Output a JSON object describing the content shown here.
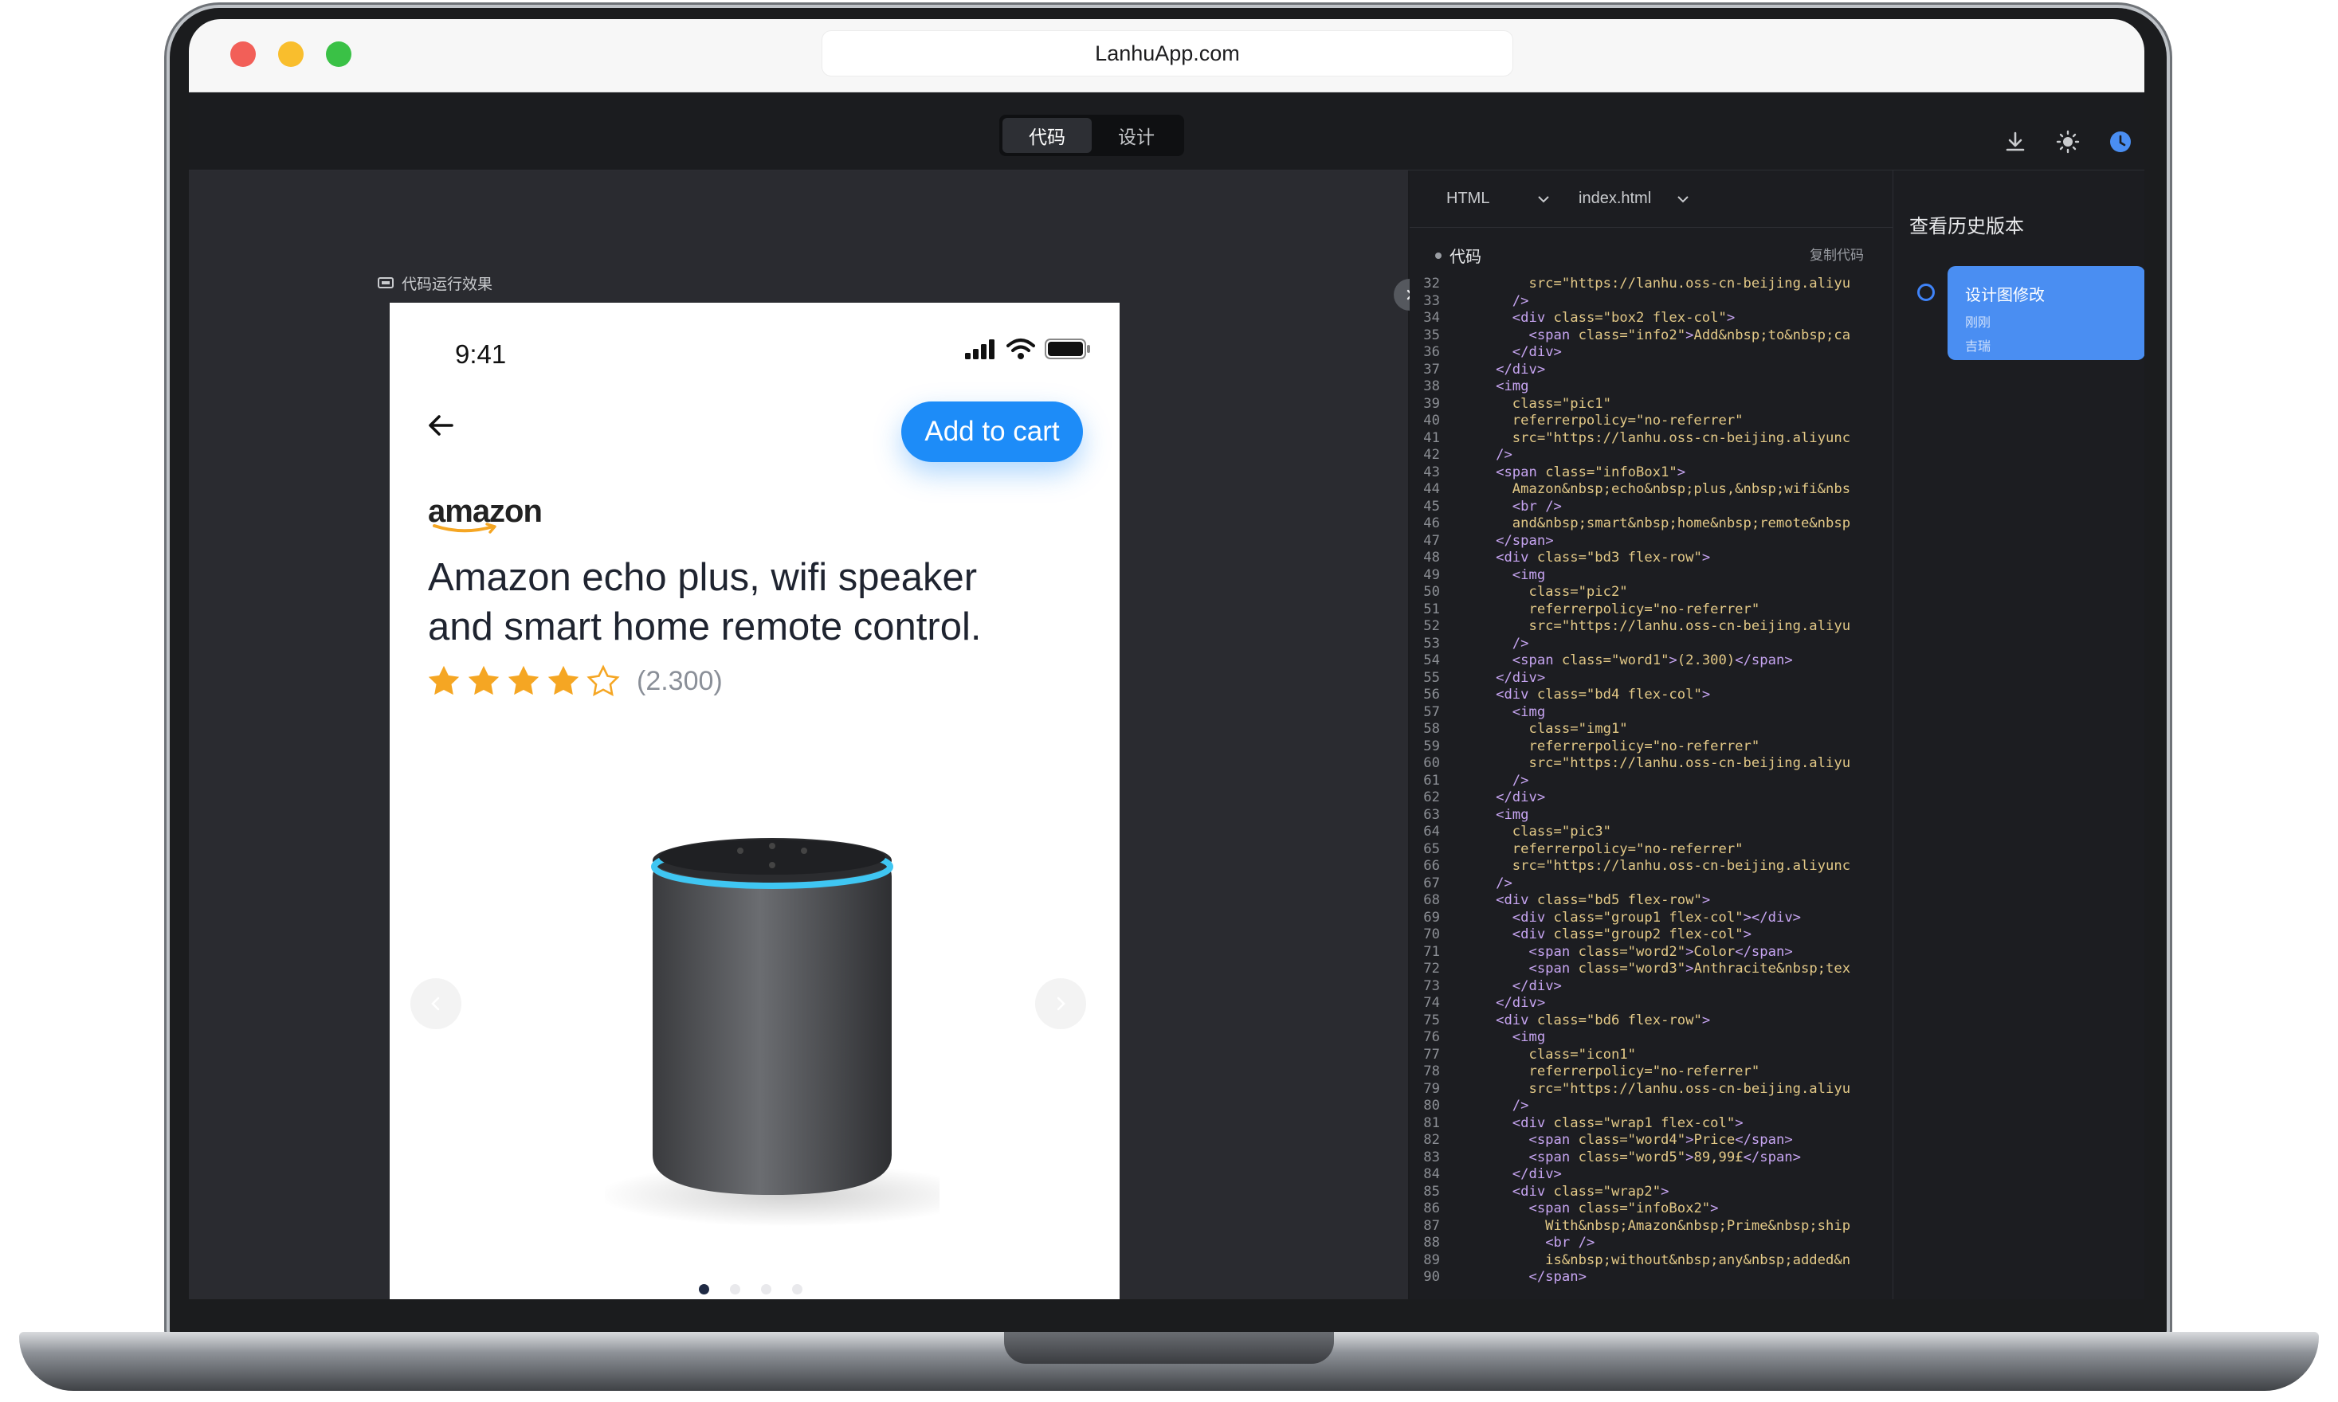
{
  "browser": {
    "url": "LanhuApp.com"
  },
  "topbar": {
    "tabs": [
      {
        "label": "代码",
        "active": true
      },
      {
        "label": "设计",
        "active": false
      }
    ],
    "icons": [
      "download-icon",
      "brightness-icon",
      "history-clock-icon"
    ]
  },
  "preview": {
    "label": "代码运行效果",
    "phone": {
      "time": "9:41",
      "add_to_cart": "Add to cart",
      "brand": "amazon",
      "title": "Amazon echo plus, wifi speaker and smart home remote control.",
      "rating_stars": 4,
      "rating_max": 5,
      "rating_count": "(2.300)",
      "carousel_pages": 4,
      "carousel_active": 1,
      "colors": {
        "accent": "#1d8cf8",
        "star": "#f5a623",
        "title": "#1f2430"
      }
    }
  },
  "code_panel": {
    "language_select": "HTML",
    "file_select": "index.html",
    "section_label": "代码",
    "copy_label": "复制代码",
    "lines": [
      {
        "n": "32",
        "t": "          src=\"https://lanhu.oss-cn-beijing.aliyu"
      },
      {
        "n": "33",
        "t": "        />"
      },
      {
        "n": "34",
        "t": "        <div class=\"box2 flex-col\">"
      },
      {
        "n": "35",
        "t": "          <span class=\"info2\">Add&nbsp;to&nbsp;ca"
      },
      {
        "n": "36",
        "t": "        </div>"
      },
      {
        "n": "37",
        "t": "      </div>"
      },
      {
        "n": "38",
        "t": "      <img"
      },
      {
        "n": "39",
        "t": "        class=\"pic1\""
      },
      {
        "n": "40",
        "t": "        referrerpolicy=\"no-referrer\""
      },
      {
        "n": "41",
        "t": "        src=\"https://lanhu.oss-cn-beijing.aliyunc"
      },
      {
        "n": "42",
        "t": "      />"
      },
      {
        "n": "43",
        "t": "      <span class=\"infoBox1\">"
      },
      {
        "n": "44",
        "t": "        Amazon&nbsp;echo&nbsp;plus,&nbsp;wifi&nbs"
      },
      {
        "n": "45",
        "t": "        <br />"
      },
      {
        "n": "46",
        "t": "        and&nbsp;smart&nbsp;home&nbsp;remote&nbsp"
      },
      {
        "n": "47",
        "t": "      </span>"
      },
      {
        "n": "48",
        "t": "      <div class=\"bd3 flex-row\">"
      },
      {
        "n": "49",
        "t": "        <img"
      },
      {
        "n": "50",
        "t": "          class=\"pic2\""
      },
      {
        "n": "51",
        "t": "          referrerpolicy=\"no-referrer\""
      },
      {
        "n": "52",
        "t": "          src=\"https://lanhu.oss-cn-beijing.aliyu"
      },
      {
        "n": "53",
        "t": "        />"
      },
      {
        "n": "54",
        "t": "        <span class=\"word1\">(2.300)</span>"
      },
      {
        "n": "55",
        "t": "      </div>"
      },
      {
        "n": "56",
        "t": "      <div class=\"bd4 flex-col\">"
      },
      {
        "n": "57",
        "t": "        <img"
      },
      {
        "n": "58",
        "t": "          class=\"img1\""
      },
      {
        "n": "59",
        "t": "          referrerpolicy=\"no-referrer\""
      },
      {
        "n": "60",
        "t": "          src=\"https://lanhu.oss-cn-beijing.aliyu"
      },
      {
        "n": "61",
        "t": "        />"
      },
      {
        "n": "62",
        "t": "      </div>"
      },
      {
        "n": "63",
        "t": "      <img"
      },
      {
        "n": "64",
        "t": "        class=\"pic3\""
      },
      {
        "n": "65",
        "t": "        referrerpolicy=\"no-referrer\""
      },
      {
        "n": "66",
        "t": "        src=\"https://lanhu.oss-cn-beijing.aliyunc"
      },
      {
        "n": "67",
        "t": "      />"
      },
      {
        "n": "68",
        "t": "      <div class=\"bd5 flex-row\">"
      },
      {
        "n": "69",
        "t": "        <div class=\"group1 flex-col\"></div>"
      },
      {
        "n": "70",
        "t": "        <div class=\"group2 flex-col\">"
      },
      {
        "n": "71",
        "t": "          <span class=\"word2\">Color</span>"
      },
      {
        "n": "72",
        "t": "          <span class=\"word3\">Anthracite&nbsp;tex"
      },
      {
        "n": "73",
        "t": "        </div>"
      },
      {
        "n": "74",
        "t": "      </div>"
      },
      {
        "n": "75",
        "t": "      <div class=\"bd6 flex-row\">"
      },
      {
        "n": "76",
        "t": "        <img"
      },
      {
        "n": "77",
        "t": "          class=\"icon1\""
      },
      {
        "n": "78",
        "t": "          referrerpolicy=\"no-referrer\""
      },
      {
        "n": "79",
        "t": "          src=\"https://lanhu.oss-cn-beijing.aliyu"
      },
      {
        "n": "80",
        "t": "        />"
      },
      {
        "n": "81",
        "t": "        <div class=\"wrap1 flex-col\">"
      },
      {
        "n": "82",
        "t": "          <span class=\"word4\">Price</span>"
      },
      {
        "n": "83",
        "t": "          <span class=\"word5\">89,99£</span>"
      },
      {
        "n": "84",
        "t": "        </div>"
      },
      {
        "n": "85",
        "t": "        <div class=\"wrap2\">"
      },
      {
        "n": "86",
        "t": "          <span class=\"infoBox2\">"
      },
      {
        "n": "87",
        "t": "            With&nbsp;Amazon&nbsp;Prime&nbsp;ship"
      },
      {
        "n": "88",
        "t": "            <br />"
      },
      {
        "n": "89",
        "t": "            is&nbsp;without&nbsp;any&nbsp;added&n"
      },
      {
        "n": "90",
        "t": "          </span>"
      }
    ]
  },
  "history": {
    "title": "查看历史版本",
    "entries": [
      {
        "title": "设计图修改",
        "time": "刚刚",
        "author": "吉瑞",
        "active": true
      }
    ]
  }
}
